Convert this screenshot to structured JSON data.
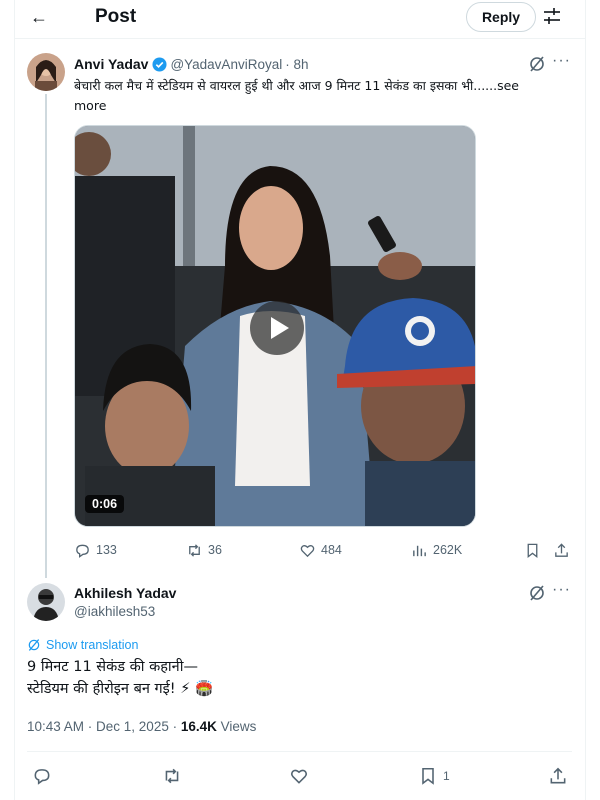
{
  "header": {
    "back_icon": "arrow-left-icon",
    "title": "Post",
    "reply_label": "Reply",
    "adjust_icon": "sliders-icon"
  },
  "quoted": {
    "name": "Anvi Yadav",
    "handle": "@YadavAnviRoyal",
    "time": "· 8h",
    "text": "बेचारी कल मैच में स्टेडियम से वायरल हुई थी और आज 9 मिनट 11 सेकंड का इसका भी......",
    "see_more": "see more",
    "video_duration": "0:06",
    "stats": {
      "replies": "133",
      "reposts": "36",
      "likes": "484",
      "views": "262K"
    },
    "colors": {
      "verified": "#1d9bf0"
    }
  },
  "reply": {
    "name": "Akhilesh Yadav",
    "handle": "@iakhilesh53",
    "show_translation": "Show translation",
    "line1": "9 मिनट 11 सेकंड की कहानी—",
    "line2": "स्टेडियम की हीरोइन बन गई! ⚡ 🏟️",
    "timestamp": "10:43 AM · Dec 1, 2025 · ",
    "views_count": "16.4K",
    "views_label": " Views",
    "bookmark_count": "1"
  },
  "colors": {
    "accent": "#1d9bf0",
    "secondary_text": "#536471",
    "border": "#eff3f4"
  }
}
